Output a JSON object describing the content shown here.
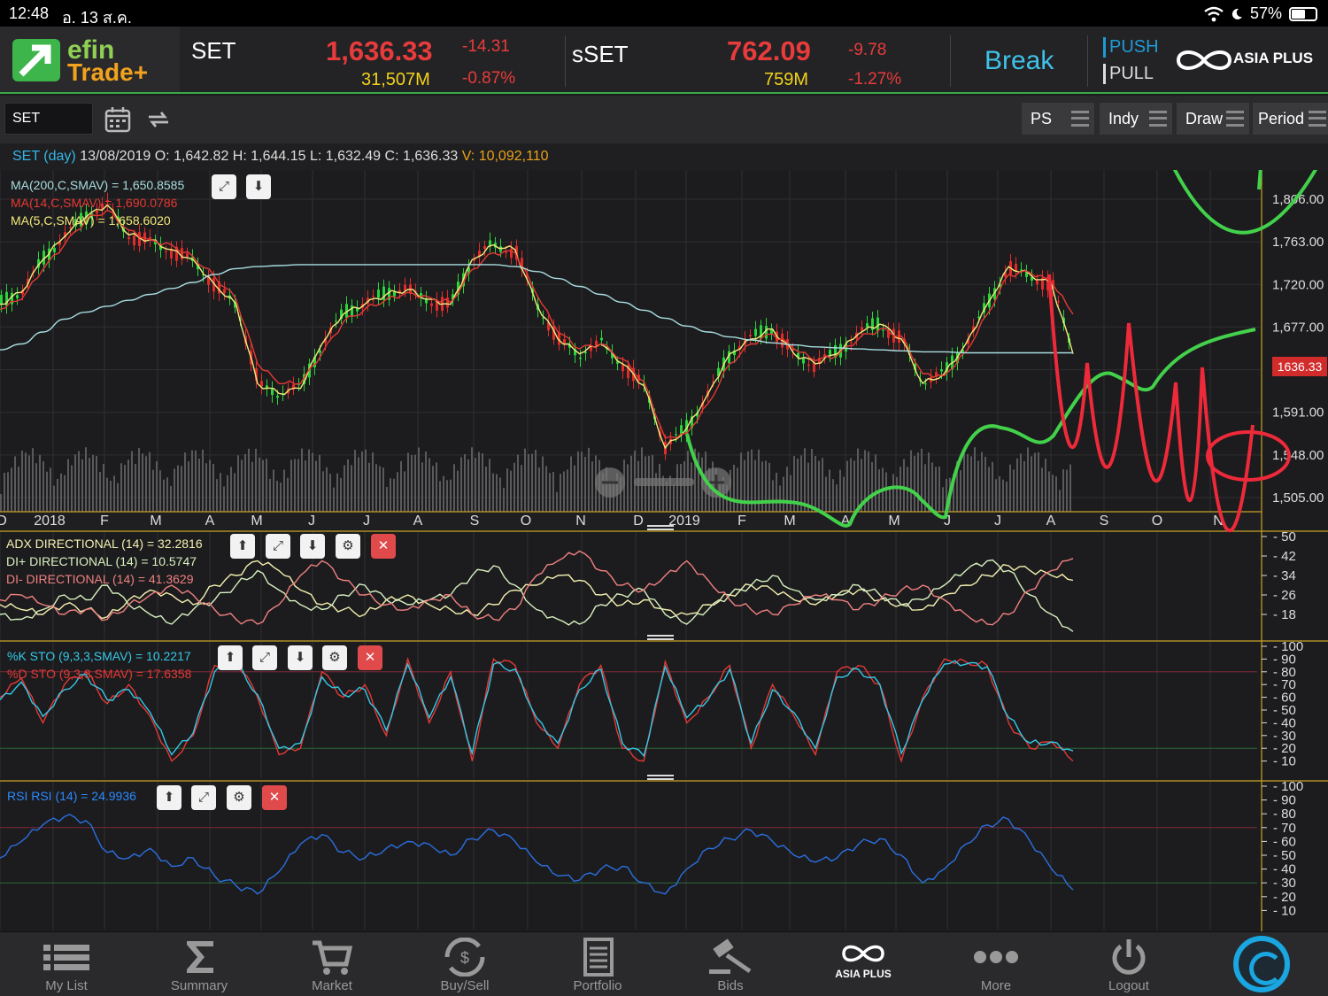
{
  "status": {
    "time": "12:48",
    "date": "อ. 13 ส.ค.",
    "battery": "57%",
    "battery_level": 0.57
  },
  "header": {
    "logo_line1": "efin",
    "logo_line2": "Trade+",
    "set": {
      "name": "SET",
      "price": "1,636.33",
      "change": "-14.31",
      "volume": "31,507M",
      "pct": "-0.87%"
    },
    "sset": {
      "name": "sSET",
      "price": "762.09",
      "change": "-9.78",
      "volume": "759M",
      "pct": "-1.27%"
    },
    "status": "Break",
    "push": "PUSH",
    "pull": "PULL",
    "broker": "ASIA PLUS"
  },
  "toolbar": {
    "symbol": "SET",
    "buttons": [
      "PS",
      "Indy",
      "Draw",
      "Period"
    ]
  },
  "info": {
    "symbol": "SET (day)",
    "date": "13/08/2019",
    "o_label": "O:",
    "o": "1,642.82",
    "h_label": "H:",
    "h": "1,644.15",
    "l_label": "L:",
    "l": "1,632.49",
    "c_label": "C:",
    "c": "1,636.33",
    "v_label": "V:",
    "v": "10,092,110"
  },
  "legends": {
    "ma200": "MA(200,C,SMAV) = 1,650.8585",
    "ma14": "MA(14,C,SMAV) = 1,690.0786",
    "ma5": "MA(5,C,SMAV) = 1,658.6020",
    "adx": "ADX DIRECTIONAL (14) = 32.2816",
    "dip": "DI+ DIRECTIONAL (14) = 10.5747",
    "dim": "DI- DIRECTIONAL (14) = 41.3629",
    "stok": "%K STO (9,3,3,SMAV) = 10.2217",
    "stod": "%D STO (9,3,3,SMAV) = 17.6358",
    "rsi": "RSI RSI (14) = 24.9936"
  },
  "colors": {
    "ma200": "#a8dde0",
    "ma14": "#e53935",
    "ma5": "#f4e97a",
    "up": "#27d63a",
    "down": "#e32a2a",
    "stok": "#33c8e8",
    "stod": "#e53935",
    "rsi": "#2a6fe0",
    "adx": "#f4f0b0",
    "dip": "#d8f0c0",
    "dim": "#f08080",
    "annot_green": "#43d14b",
    "annot_red": "#ee2a3a"
  },
  "last_price": "1636.33",
  "chart_data": [
    {
      "type": "line",
      "title": "SET (day)",
      "y_ticks": [
        "1,806.00",
        "1,763.00",
        "1,720.00",
        "1,677.00",
        "1,634.00",
        "1,591.00",
        "1,548.00",
        "1,505.00"
      ],
      "x_ticks": [
        "D",
        "2018",
        "F",
        "M",
        "A",
        "M",
        "J",
        "J",
        "A",
        "S",
        "O",
        "N",
        "D",
        "2019",
        "F",
        "M",
        "A",
        "M",
        "J",
        "J",
        "A",
        "S",
        "O",
        "N"
      ],
      "ylim": [
        1505,
        1806
      ],
      "series": [
        {
          "name": "MA(5,C,SMAV)",
          "values": [
            1700,
            1712,
            1745,
            1768,
            1788,
            1800,
            1770,
            1765,
            1755,
            1745,
            1720,
            1700,
            1620,
            1610,
            1615,
            1660,
            1690,
            1700,
            1710,
            1715,
            1705,
            1700,
            1745,
            1760,
            1755,
            1700,
            1665,
            1650,
            1660,
            1640,
            1618,
            1555,
            1575,
            1610,
            1650,
            1665,
            1675,
            1650,
            1640,
            1650,
            1670,
            1680,
            1665,
            1620,
            1630,
            1660,
            1700,
            1738,
            1730,
            1720,
            1650
          ]
        },
        {
          "name": "MA(14,C,SMAV)",
          "values": [
            1695,
            1705,
            1735,
            1760,
            1785,
            1795,
            1775,
            1765,
            1760,
            1748,
            1728,
            1705,
            1640,
            1620,
            1620,
            1650,
            1682,
            1695,
            1705,
            1712,
            1707,
            1702,
            1735,
            1752,
            1752,
            1710,
            1672,
            1655,
            1660,
            1645,
            1622,
            1565,
            1570,
            1600,
            1640,
            1660,
            1670,
            1655,
            1643,
            1648,
            1665,
            1675,
            1668,
            1630,
            1628,
            1652,
            1690,
            1730,
            1732,
            1722,
            1690
          ]
        },
        {
          "name": "MA(200,C,SMAV)",
          "values": [
            1654,
            1660,
            1672,
            1685,
            1692,
            1698,
            1704,
            1710,
            1716,
            1722,
            1730,
            1736,
            1738,
            1739,
            1740,
            1740,
            1740,
            1740,
            1740,
            1740,
            1740,
            1740,
            1740,
            1740,
            1738,
            1733,
            1726,
            1718,
            1710,
            1702,
            1694,
            1686,
            1678,
            1672,
            1667,
            1664,
            1661,
            1659,
            1657,
            1656,
            1655,
            1654,
            1653,
            1652,
            1652,
            1651,
            1651,
            1651,
            1651,
            1651,
            1651
          ]
        }
      ]
    },
    {
      "type": "line",
      "title": "ADX DIRECTIONAL",
      "y_ticks": [
        "50",
        "42",
        "34",
        "26",
        "18"
      ],
      "ylim": [
        10,
        50
      ],
      "series": [
        {
          "name": "ADX DIRECTIONAL (14)",
          "values": [
            22,
            20,
            18,
            22,
            20,
            17,
            24,
            28,
            26,
            22,
            30,
            34,
            40,
            36,
            28,
            22,
            20,
            18,
            24,
            26,
            22,
            20,
            18,
            22,
            28,
            30,
            34,
            32,
            26,
            22,
            24,
            20,
            18,
            22,
            26,
            30,
            28,
            24,
            22,
            26,
            28,
            24,
            22,
            20,
            26,
            30,
            34,
            38,
            36,
            34,
            32
          ]
        },
        {
          "name": "DI+ DIRECTIONAL (14)",
          "values": [
            18,
            16,
            20,
            26,
            24,
            30,
            22,
            18,
            14,
            20,
            24,
            30,
            36,
            28,
            22,
            20,
            26,
            30,
            24,
            22,
            24,
            26,
            34,
            38,
            30,
            20,
            16,
            14,
            22,
            26,
            28,
            18,
            14,
            20,
            26,
            30,
            34,
            28,
            24,
            26,
            30,
            26,
            22,
            24,
            30,
            36,
            40,
            36,
            26,
            18,
            11
          ]
        },
        {
          "name": "DI- DIRECTIONAL (14)",
          "values": [
            24,
            26,
            22,
            18,
            20,
            16,
            22,
            26,
            30,
            26,
            20,
            16,
            14,
            22,
            34,
            40,
            32,
            26,
            22,
            20,
            24,
            26,
            18,
            16,
            20,
            34,
            40,
            44,
            36,
            30,
            28,
            34,
            40,
            32,
            24,
            20,
            18,
            22,
            26,
            24,
            20,
            24,
            28,
            30,
            24,
            18,
            14,
            18,
            28,
            36,
            41
          ]
        }
      ]
    },
    {
      "type": "line",
      "title": "%K STO",
      "y_ticks": [
        "100",
        "90",
        "80",
        "70",
        "60",
        "50",
        "40",
        "30",
        "20",
        "10"
      ],
      "ylim": [
        0,
        100
      ],
      "series": [
        {
          "name": "%K STO (9,3,3,SMAV)",
          "values": [
            60,
            75,
            40,
            70,
            80,
            55,
            70,
            45,
            10,
            30,
            85,
            90,
            60,
            15,
            20,
            80,
            60,
            70,
            30,
            90,
            40,
            80,
            10,
            90,
            85,
            40,
            20,
            70,
            85,
            20,
            10,
            88,
            40,
            60,
            85,
            20,
            70,
            45,
            15,
            80,
            85,
            70,
            10,
            60,
            90,
            88,
            85,
            40,
            20,
            25,
            10
          ]
        },
        {
          "name": "%D STO (9,3,3,SMAV)",
          "values": [
            58,
            72,
            45,
            66,
            78,
            58,
            66,
            48,
            15,
            32,
            80,
            87,
            62,
            20,
            24,
            76,
            62,
            66,
            34,
            86,
            44,
            76,
            16,
            86,
            82,
            44,
            24,
            66,
            82,
            24,
            14,
            84,
            44,
            58,
            82,
            24,
            66,
            48,
            20,
            76,
            82,
            70,
            16,
            58,
            86,
            86,
            84,
            44,
            24,
            25,
            18
          ]
        }
      ]
    },
    {
      "type": "line",
      "title": "RSI",
      "y_ticks": [
        "100",
        "90",
        "80",
        "70",
        "60",
        "50",
        "40",
        "30",
        "20",
        "10"
      ],
      "ylim": [
        0,
        100
      ],
      "series": [
        {
          "name": "RSI RSI (14)",
          "values": [
            48,
            60,
            72,
            78,
            75,
            52,
            48,
            55,
            42,
            48,
            35,
            28,
            22,
            38,
            58,
            65,
            52,
            48,
            55,
            60,
            58,
            50,
            62,
            68,
            60,
            45,
            35,
            32,
            40,
            42,
            30,
            22,
            40,
            55,
            62,
            68,
            60,
            50,
            45,
            48,
            58,
            62,
            50,
            30,
            40,
            58,
            72,
            76,
            60,
            40,
            25
          ]
        }
      ]
    }
  ],
  "tabs": [
    "My List",
    "Summary",
    "Market",
    "Buy/Sell",
    "Portfolio",
    "Bids",
    "ASIA PLUS",
    "More",
    "Logout"
  ]
}
